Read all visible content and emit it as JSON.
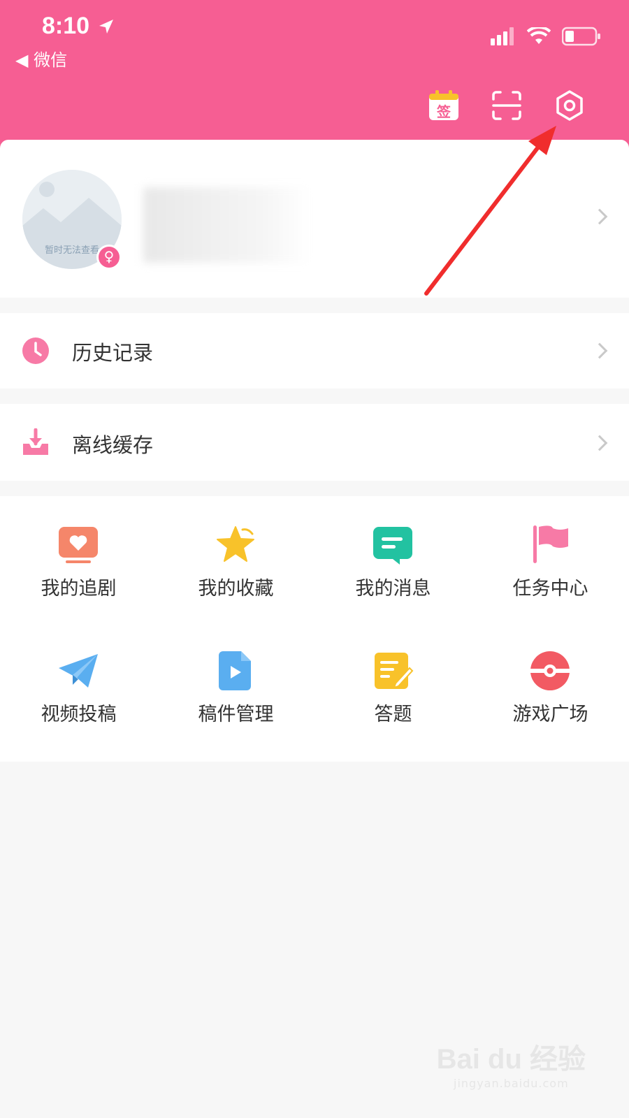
{
  "status_bar": {
    "time": "8:10",
    "back_label": "◀ 微信"
  },
  "header": {
    "icons": [
      "sign-in-calendar-icon",
      "scan-icon",
      "settings-gear-icon"
    ],
    "sign_label": "签",
    "accent_color": "#f65e93"
  },
  "profile": {
    "avatar_placeholder_text": "暂时无法查看",
    "gender_symbol": "♀"
  },
  "rows": [
    {
      "label": "历史记录",
      "icon": "history-clock-icon"
    },
    {
      "label": "离线缓存",
      "icon": "offline-download-icon"
    }
  ],
  "grid": [
    {
      "label": "我的追剧",
      "icon": "tv-heart-icon",
      "color": "#f5866a"
    },
    {
      "label": "我的收藏",
      "icon": "star-icon",
      "color": "#f8c22a"
    },
    {
      "label": "我的消息",
      "icon": "message-icon",
      "color": "#22c2a1"
    },
    {
      "label": "任务中心",
      "icon": "flag-icon",
      "color": "#f77aa6"
    },
    {
      "label": "视频投稿",
      "icon": "paper-plane-icon",
      "color": "#5aaef0"
    },
    {
      "label": "稿件管理",
      "icon": "video-file-icon",
      "color": "#5aaef0"
    },
    {
      "label": "答题",
      "icon": "edit-note-icon",
      "color": "#f8c22a"
    },
    {
      "label": "游戏广场",
      "icon": "game-ball-icon",
      "color": "#f25a63"
    }
  ],
  "watermark": {
    "main": "Bai du 经验",
    "sub": "jingyan.baidu.com"
  }
}
